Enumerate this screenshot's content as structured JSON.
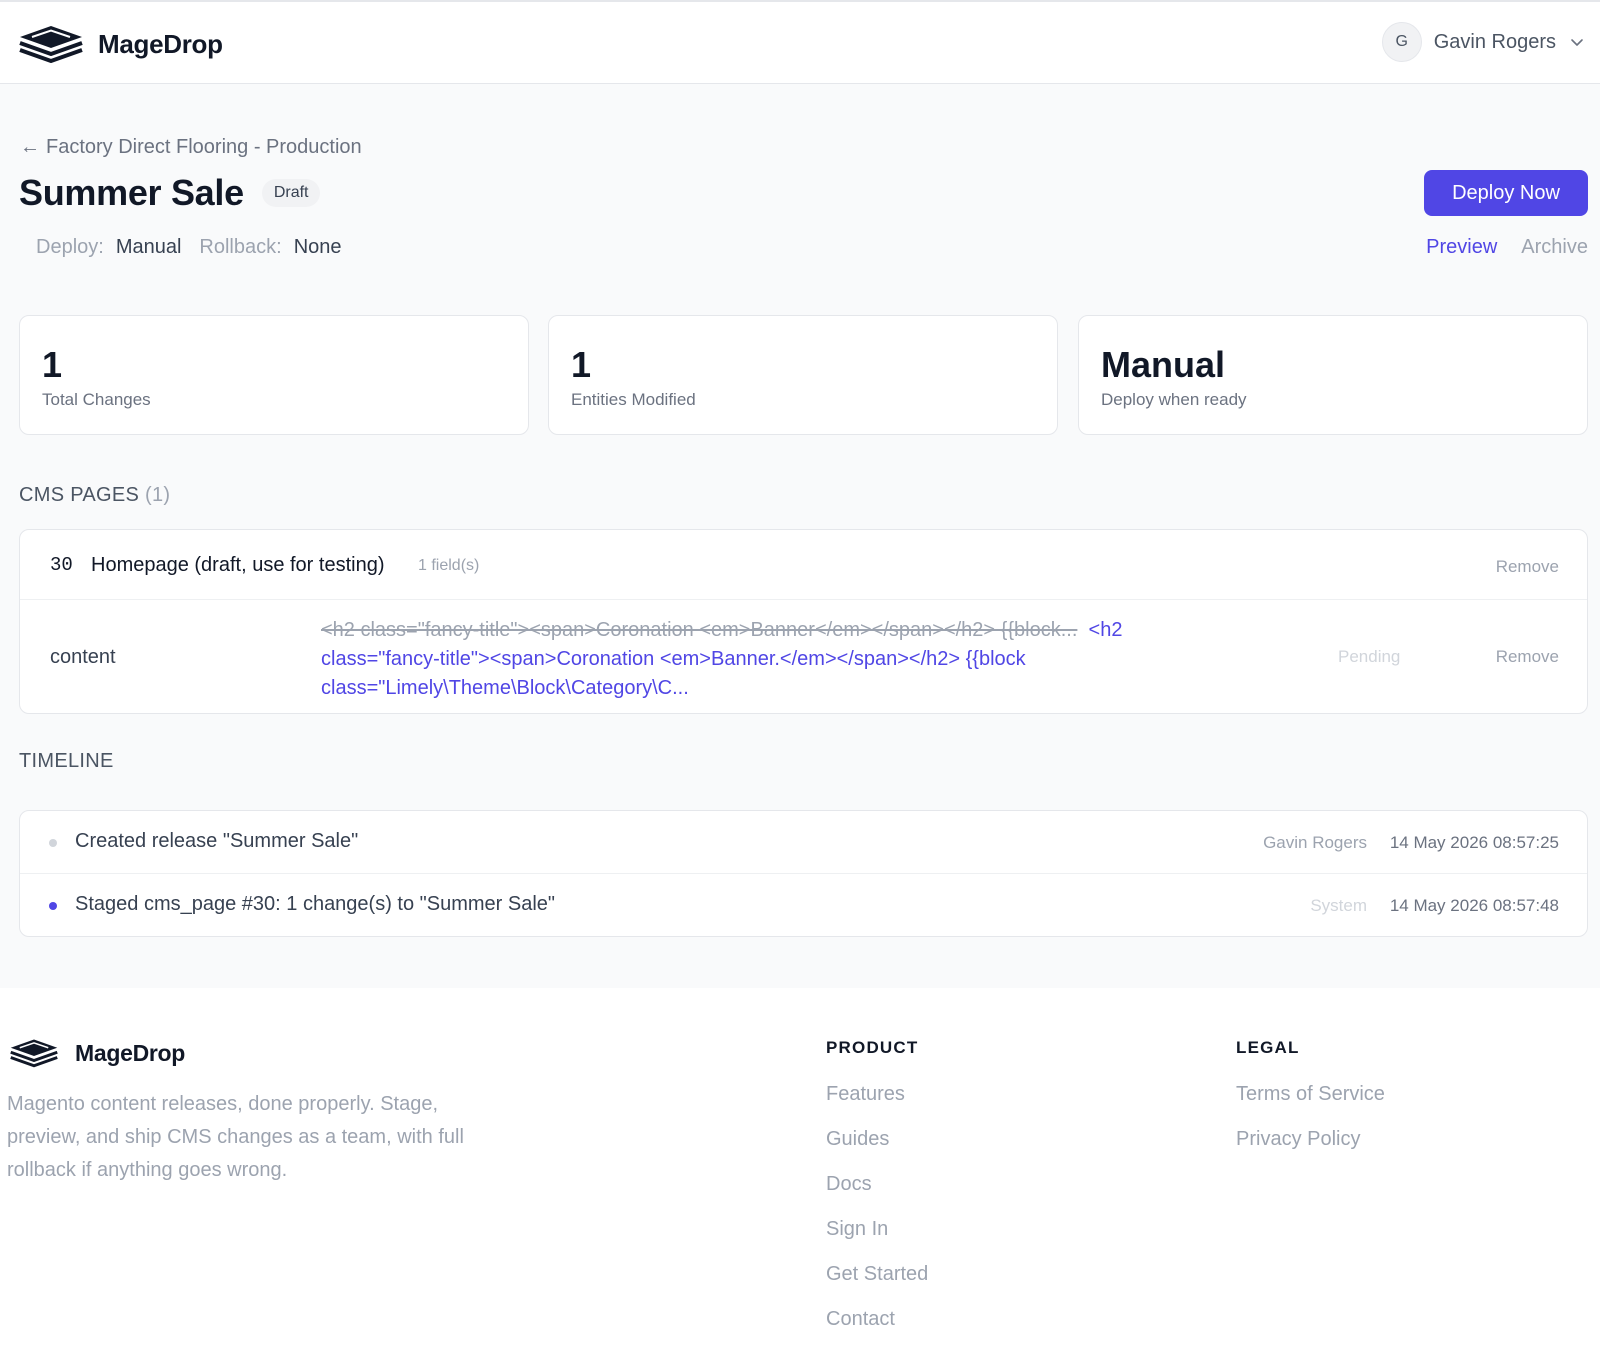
{
  "header": {
    "brand": "MageDrop",
    "user": {
      "initial": "G",
      "name": "Gavin Rogers"
    }
  },
  "release": {
    "breadcrumb": "Factory Direct Flooring - Production",
    "title": "Summer Sale",
    "status": "Draft",
    "deploy_label": "Deploy:",
    "deploy_value": "Manual",
    "rollback_label": "Rollback:",
    "rollback_value": "None",
    "deploy_button": "Deploy Now",
    "preview_link": "Preview",
    "archive_link": "Archive"
  },
  "stats": [
    {
      "value": "1",
      "label": "Total Changes"
    },
    {
      "value": "1",
      "label": "Entities Modified"
    },
    {
      "value": "Manual",
      "label": "Deploy when ready"
    }
  ],
  "cms_pages": {
    "heading": "CMS PAGES",
    "count": "(1)",
    "entity": {
      "id": "30",
      "name": "Homepage (draft, use for testing)",
      "fields": "1 field(s)",
      "remove": "Remove"
    },
    "change": {
      "field": "content",
      "old_value": "<h2 class=\"fancy-title\"><span>Coronation <em>Banner</em></span></h2> {{block...",
      "new_value": "<h2 class=\"fancy-title\"><span>Coronation <em>Banner.</em></span></h2> {{block class=\"Limely\\Theme\\Block\\Category\\C...",
      "status": "Pending",
      "remove": "Remove"
    }
  },
  "timeline": {
    "heading": "TIMELINE",
    "events": [
      {
        "text": "Created release \"Summer Sale\"",
        "actor": "Gavin Rogers",
        "time": "14 May 2026 08:57:25",
        "dot_color": "#d1d5db",
        "actor_color": "#9ca3af"
      },
      {
        "text": "Staged cms_page #30: 1 change(s) to \"Summer Sale\"",
        "actor": "System",
        "time": "14 May 2026 08:57:48",
        "dot_color": "#5046e5",
        "actor_color": "#d1d5db"
      }
    ]
  },
  "footer": {
    "brand": "MageDrop",
    "tagline": "Magento content releases, done properly. Stage, preview, and ship CMS changes as a team, with full rollback if anything goes wrong.",
    "product": {
      "heading": "PRODUCT",
      "links": [
        "Features",
        "Guides",
        "Docs",
        "Sign In",
        "Get Started",
        "Contact"
      ]
    },
    "legal": {
      "heading": "LEGAL",
      "links": [
        "Terms of Service",
        "Privacy Policy"
      ]
    }
  },
  "colors": {
    "accent": "#5046e5",
    "muted": "#9ca3af",
    "page_bg": "#f9fafb"
  }
}
